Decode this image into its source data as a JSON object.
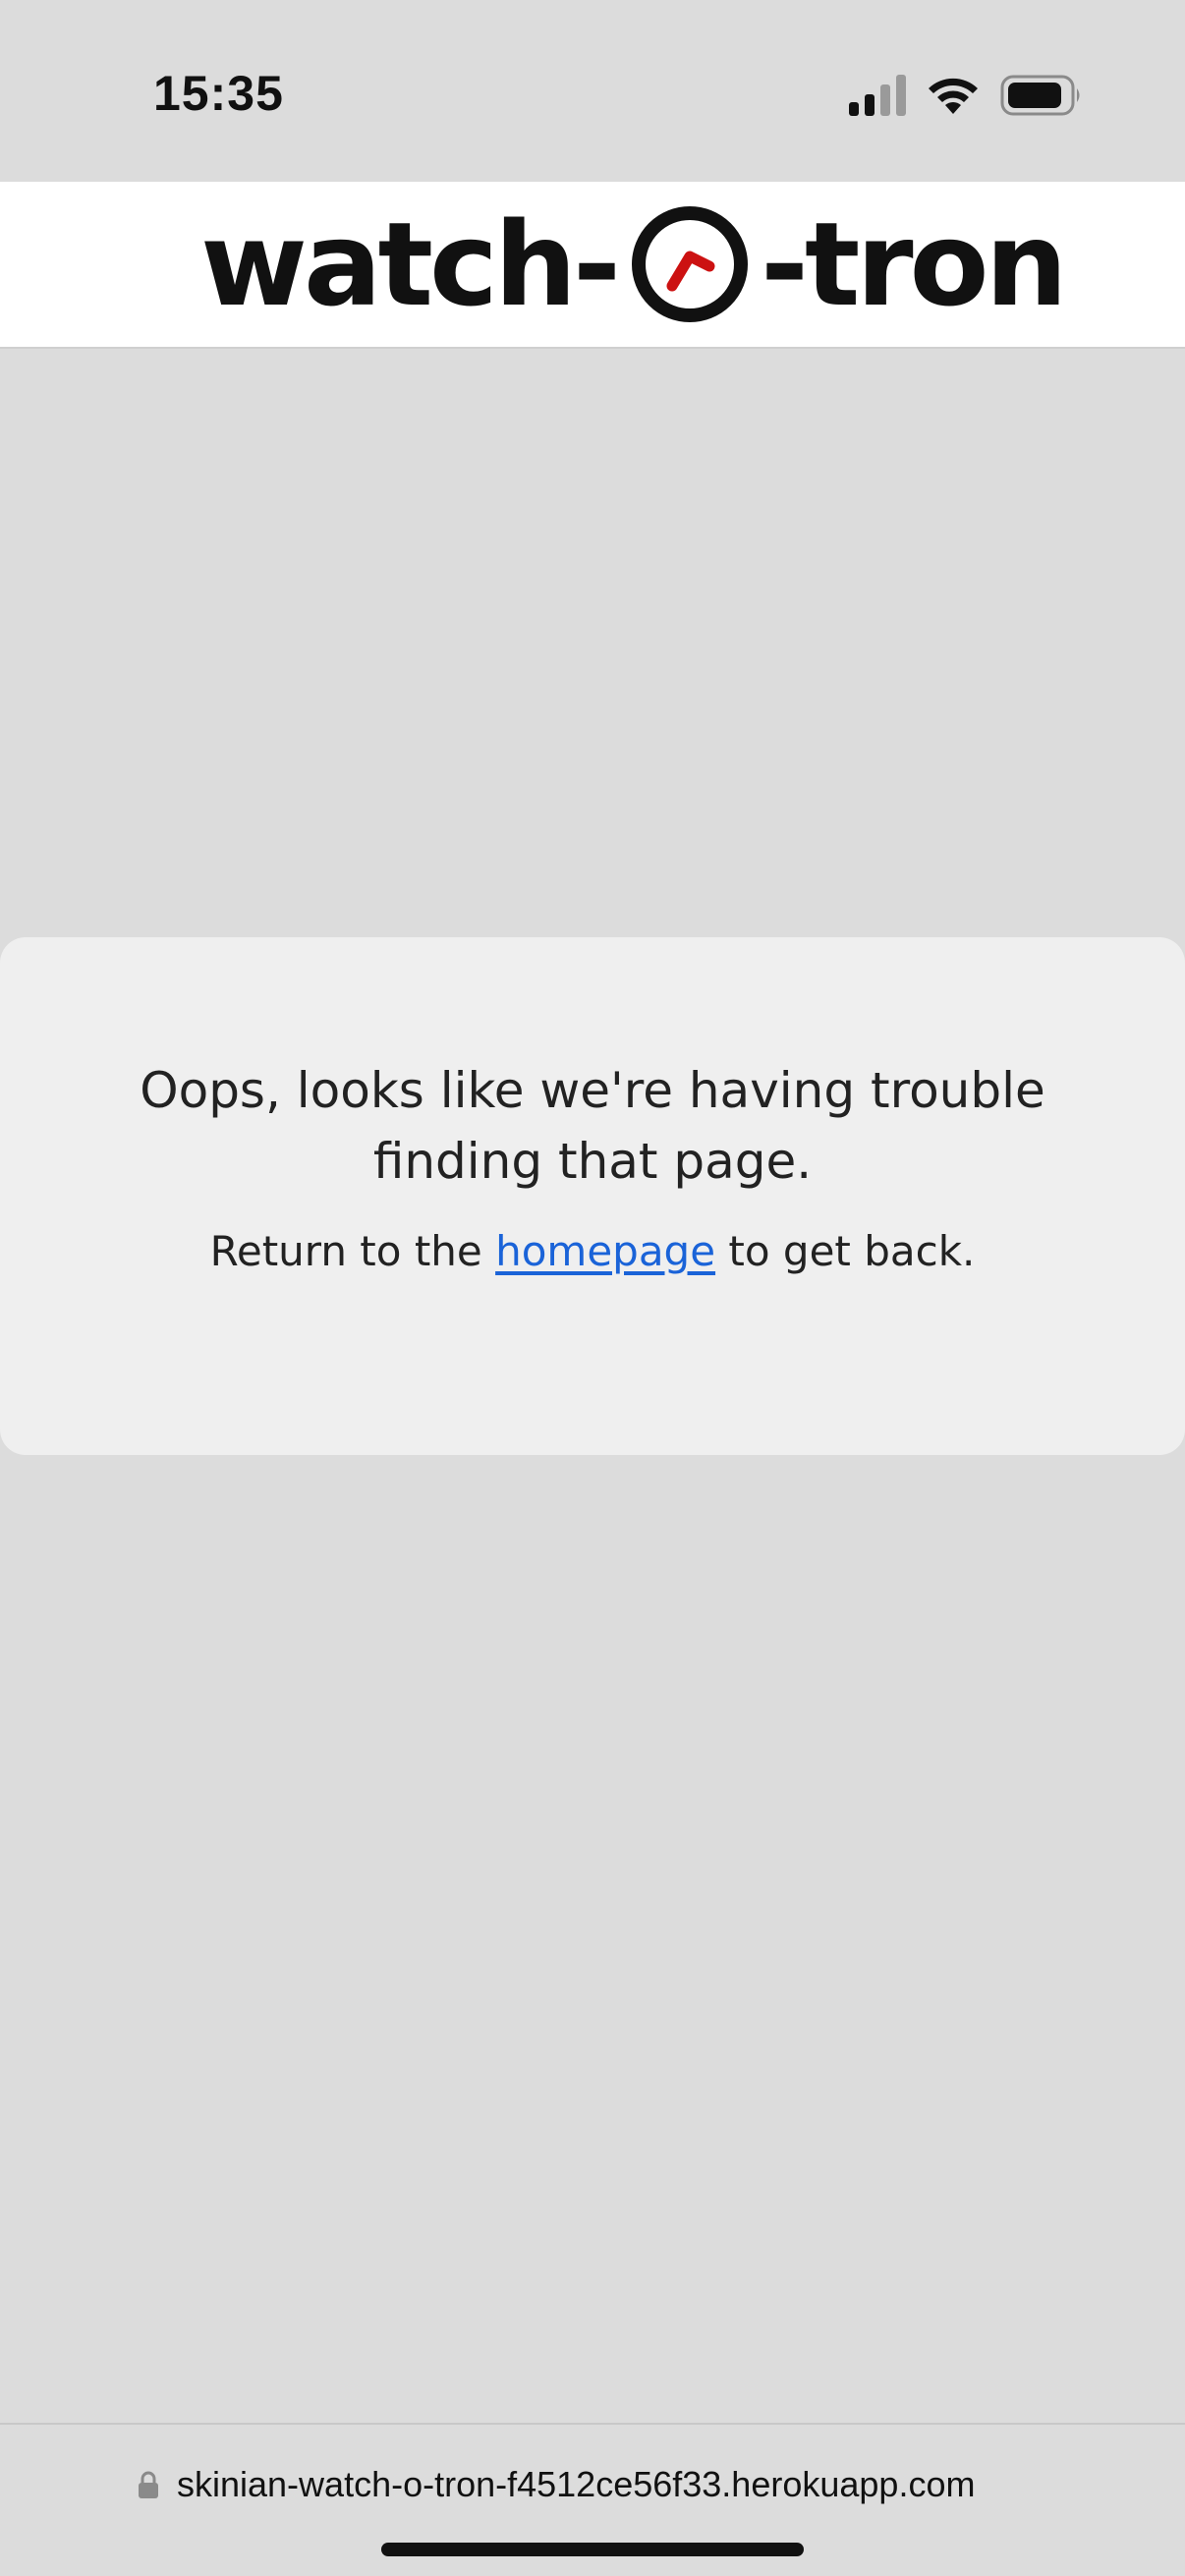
{
  "status_bar": {
    "time": "15:35"
  },
  "header": {
    "logo_left": "watch-",
    "logo_right": "-tron",
    "logo_icon": "clock-icon",
    "accent_color": "#cc1111"
  },
  "error": {
    "title": "Oops, looks like we're having trouble finding that page.",
    "message_before": "Return to the ",
    "link_label": "homepage",
    "message_after": " to get back.",
    "link_color": "#1a63d8"
  },
  "browser": {
    "url": "skinian-watch-o-tron-f4512ce56f33.herokuapp.com",
    "url_icon": "lock-icon"
  }
}
